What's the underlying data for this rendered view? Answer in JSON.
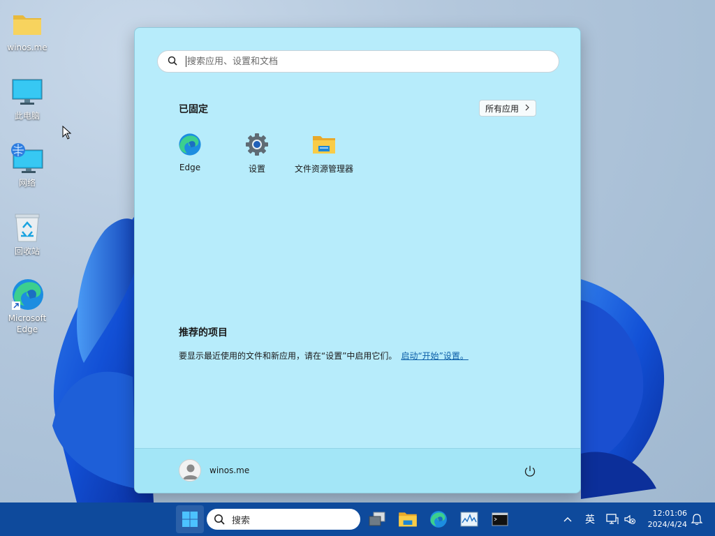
{
  "desktop": {
    "icons": [
      {
        "label": "winos.me",
        "icon": "folder-icon"
      },
      {
        "label": "此电脑",
        "icon": "monitor-icon"
      },
      {
        "label": "网络",
        "icon": "network-icon"
      },
      {
        "label": "回收站",
        "icon": "recycle-bin-icon"
      },
      {
        "label": "Microsoft Edge",
        "icon": "edge-icon"
      }
    ]
  },
  "start_menu": {
    "search_placeholder": "搜索应用、设置和文档",
    "pinned_title": "已固定",
    "all_apps_label": "所有应用",
    "pinned_apps": [
      {
        "label": "Edge",
        "icon": "edge-icon"
      },
      {
        "label": "设置",
        "icon": "gear-icon"
      },
      {
        "label": "文件资源管理器",
        "icon": "folder-icon"
      }
    ],
    "recommended_title": "推荐的项目",
    "recommended_text": "要显示最近使用的文件和新应用，请在“设置”中启用它们。",
    "recommended_link": "启动“开始”设置。",
    "user_name": "winos.me"
  },
  "taskbar": {
    "search_label": "搜索",
    "apps": [
      "task-view-icon",
      "file-explorer-icon",
      "edge-icon",
      "performance-monitor-icon",
      "terminal-icon"
    ],
    "tray": {
      "ime": "英",
      "time": "12:01:06",
      "date": "2024/4/24"
    }
  },
  "colors": {
    "start_bg": "#b7ecfb",
    "taskbar_bg": "#0e4a9c",
    "link": "#0a5ea8"
  }
}
